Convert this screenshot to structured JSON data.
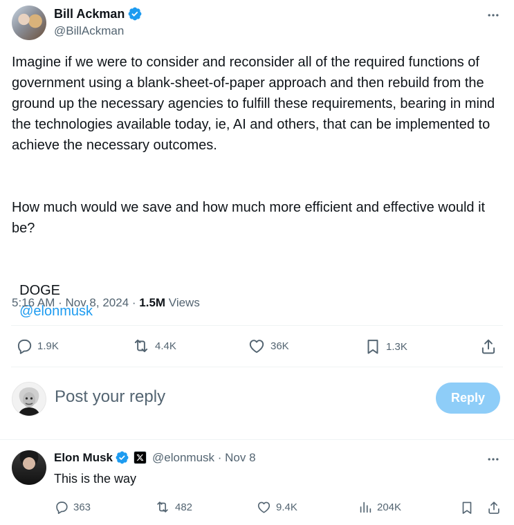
{
  "main_post": {
    "author_name": "Bill Ackman",
    "handle": "@BillAckman",
    "paragraph1": "Imagine if we were to consider and reconsider all of the required functions of government using a blank-sheet-of-paper approach and then rebuild from the ground up the necessary agencies to fulfill these requirements, bearing in mind the technologies available today, ie, AI and others, that can be implemented to achieve the necessary outcomes.",
    "paragraph2": "How much would we save and how much more efficient and effective would it be?",
    "tag_text": "DOGE",
    "mention": "@elonmusk",
    "timestamp": "5:16 AM · Nov 8, 2024 · ",
    "views_count": "1.5M",
    "views_label": " Views",
    "stats": {
      "replies": "1.9K",
      "reposts": "4.4K",
      "likes": "36K",
      "bookmarks": "1.3K"
    }
  },
  "reply_box": {
    "placeholder": "Post your reply",
    "button_label": "Reply"
  },
  "reply_post": {
    "author_name": "Elon Musk",
    "handle_date": "@elonmusk · Nov 8",
    "text": "This is the way",
    "stats": {
      "replies": "363",
      "reposts": "482",
      "likes": "9.4K",
      "views": "204K"
    }
  },
  "colors": {
    "verified": "#1d9bf0",
    "link": "#1d9bf0",
    "reply_button_bg": "#8ecdf8",
    "muted_text": "#536471"
  },
  "icons": [
    "more-icon",
    "verified-badge-icon",
    "x-logo-icon",
    "reply-icon",
    "repost-icon",
    "like-icon",
    "bookmark-icon",
    "share-icon",
    "views-icon"
  ]
}
